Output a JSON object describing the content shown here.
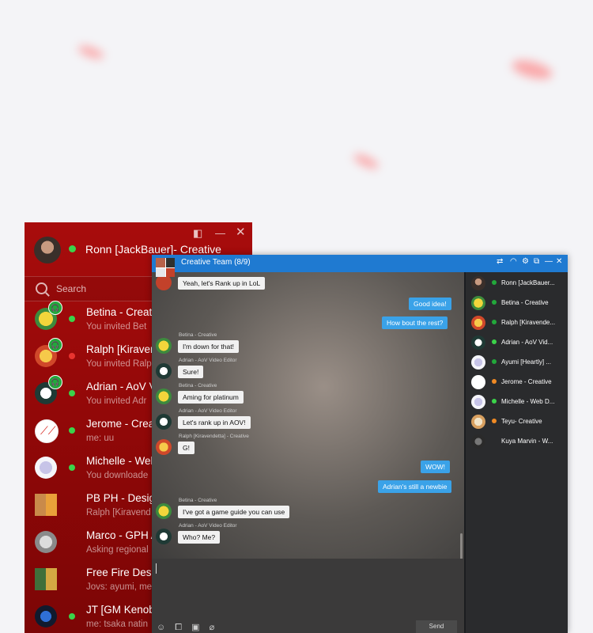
{
  "main_window": {
    "user_name": "Ronn [JackBauer]- Creative",
    "search_placeholder": "Search",
    "contacts": [
      {
        "name": "Betina - Creati",
        "sub": "You invited Bet",
        "status": "online",
        "badge": "headset-icon"
      },
      {
        "name": "Ralph [Kiraven",
        "sub": "You invited Ralp",
        "status": "busy",
        "badge": "headset-icon"
      },
      {
        "name": "Adrian - AoV V",
        "sub": "You invited Adr",
        "status": "online",
        "badge": "headset-icon"
      },
      {
        "name": "Jerome - Crea",
        "sub": "me: uu",
        "status": "online"
      },
      {
        "name": "Michelle - Web",
        "sub": "You downloade",
        "status": "online"
      },
      {
        "name": "PB PH - Desig",
        "sub": "Ralph [Kiravend",
        "status": "none"
      },
      {
        "name": "Marco - GPH A",
        "sub": "Asking regional",
        "status": "none"
      },
      {
        "name": "Free Fire Desig",
        "sub": "Jovs: ayumi, me",
        "status": "none"
      },
      {
        "name": "JT [GM Kenob",
        "sub": "me: tsaka natin",
        "status": "online"
      }
    ]
  },
  "chat_window": {
    "title": "Creative Team (8/9)",
    "send_label": "Send",
    "members": [
      {
        "name": "Ronn [JackBauer...",
        "status": "headset"
      },
      {
        "name": "Betina - Creative",
        "status": "headset"
      },
      {
        "name": "Ralph [Kiravende...",
        "status": "headset"
      },
      {
        "name": "Adrian - AoV Vid...",
        "status": "online"
      },
      {
        "name": "Ayumi [Heartly] ...",
        "status": "headset"
      },
      {
        "name": "Jerome - Creative",
        "status": "away"
      },
      {
        "name": "Michelle - Web D...",
        "status": "online"
      },
      {
        "name": "Teyu- Creative",
        "status": "away"
      },
      {
        "name": "Kuya Marvin - W...",
        "status": "none"
      }
    ],
    "messages": [
      {
        "dir": "in",
        "sender": "",
        "text": "Yeah, let's Rank up in LoL"
      },
      {
        "dir": "out",
        "text": "Good idea!"
      },
      {
        "dir": "out",
        "text": "How bout the rest?"
      },
      {
        "dir": "in",
        "sender": "Betina - Creative",
        "text": "I'm down for that!"
      },
      {
        "dir": "in",
        "sender": "Adrian - AoV Video Editor",
        "text": "Sure!"
      },
      {
        "dir": "in",
        "sender": "Betina - Creative",
        "text": "Aming for platinum"
      },
      {
        "dir": "in",
        "sender": "Adrian - AoV Video Editor",
        "text": "Let's rank up in AOV!"
      },
      {
        "dir": "in",
        "sender": "Ralph [Kiravendetta] - Creative",
        "text": "G!"
      },
      {
        "dir": "out",
        "text": "WOW!"
      },
      {
        "dir": "out",
        "text": "Adrian's still a newbie"
      },
      {
        "dir": "in",
        "sender": "Betina - Creative",
        "text": "I've got a game guide you can use"
      },
      {
        "dir": "in",
        "sender": "Adrian - AoV Video Editor",
        "text": "Who? Me?"
      }
    ]
  },
  "colors": {
    "main_bg": "#9c0a0a",
    "chat_titlebar": "#1f7ad1",
    "outgoing_bubble": "#3aa2e8",
    "online": "#3bd34a",
    "busy": "#e8342f",
    "away": "#f08a24"
  }
}
